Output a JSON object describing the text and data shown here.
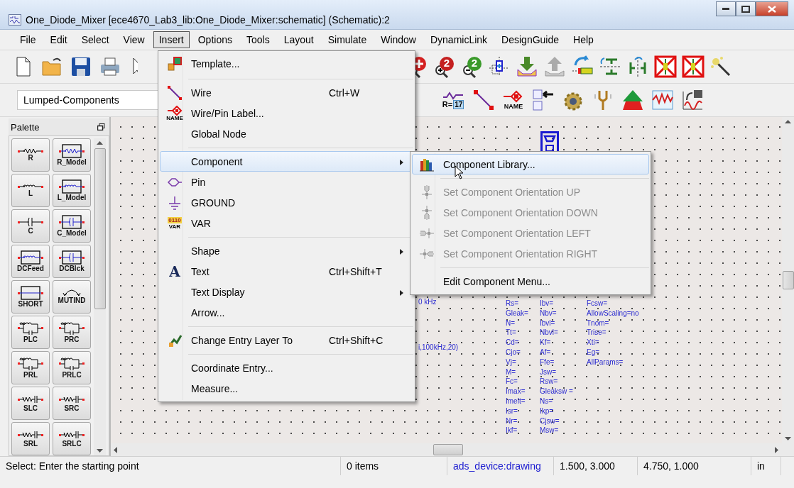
{
  "window": {
    "title": "One_Diode_Mixer [ece4670_Lab3_lib:One_Diode_Mixer:schematic] (Schematic):2"
  },
  "menu_bar": [
    {
      "label": "File",
      "selected": false
    },
    {
      "label": "Edit",
      "selected": false
    },
    {
      "label": "Select",
      "selected": false
    },
    {
      "label": "View",
      "selected": false
    },
    {
      "label": "Insert",
      "selected": true
    },
    {
      "label": "Options",
      "selected": false
    },
    {
      "label": "Tools",
      "selected": false
    },
    {
      "label": "Layout",
      "selected": false
    },
    {
      "label": "Simulate",
      "selected": false
    },
    {
      "label": "Window",
      "selected": false
    },
    {
      "label": "DynamicLink",
      "selected": false
    },
    {
      "label": "DesignGuide",
      "selected": false
    },
    {
      "label": "Help",
      "selected": false
    }
  ],
  "toolbar_1": {
    "left": [
      {
        "kind": "new"
      },
      {
        "kind": "open"
      },
      {
        "kind": "save"
      },
      {
        "kind": "print"
      },
      {
        "kind": "pointer"
      }
    ],
    "right": [
      {
        "kind": "zoom-in"
      },
      {
        "kind": "zoom-in-2",
        "glyph": "2"
      },
      {
        "kind": "zoom-out-2",
        "glyph": "2"
      },
      {
        "kind": "center"
      },
      {
        "kind": "push-down"
      },
      {
        "kind": "pop-up"
      },
      {
        "kind": "rotate"
      },
      {
        "kind": "mirror-x"
      },
      {
        "kind": "mirror-y"
      },
      {
        "kind": "deactivate"
      },
      {
        "kind": "deactivate-short"
      },
      {
        "kind": "wand"
      }
    ]
  },
  "toolbar_2": {
    "library": "Lumped-Components",
    "tools": [
      {
        "kind": "equation",
        "text": "R=",
        "glyph": "17"
      },
      {
        "kind": "wire"
      },
      {
        "kind": "name",
        "text": "NAME"
      },
      {
        "kind": "copy-schematic"
      },
      {
        "kind": "gear"
      },
      {
        "kind": "tuning-fork"
      },
      {
        "kind": "optimize"
      },
      {
        "kind": "graph"
      },
      {
        "kind": "graph-save"
      }
    ]
  },
  "palette": {
    "title": "Palette",
    "items": [
      {
        "label": "R",
        "kind": "resistor",
        "boxed": false
      },
      {
        "label": "R_Model",
        "kind": "resistor",
        "boxed": true
      },
      {
        "label": "L",
        "kind": "inductor",
        "boxed": false
      },
      {
        "label": "L_Model",
        "kind": "inductor",
        "boxed": true
      },
      {
        "label": "C",
        "kind": "capacitor",
        "boxed": false
      },
      {
        "label": "C_Model",
        "kind": "capacitor",
        "boxed": true
      },
      {
        "label": "DCFeed",
        "kind": "inductor",
        "boxed": true
      },
      {
        "label": "DCBlck",
        "kind": "capacitor",
        "boxed": true
      },
      {
        "label": "SHORT",
        "kind": "short",
        "boxed": true
      },
      {
        "label": "MUTIND",
        "kind": "mutual",
        "boxed": false
      },
      {
        "label": "PLC",
        "kind": "parallel",
        "boxed": false
      },
      {
        "label": "PRC",
        "kind": "parallel",
        "boxed": false
      },
      {
        "label": "PRL",
        "kind": "parallel",
        "boxed": false
      },
      {
        "label": "PRLC",
        "kind": "parallel",
        "boxed": false
      },
      {
        "label": "SLC",
        "kind": "series",
        "boxed": false
      },
      {
        "label": "SRC",
        "kind": "series",
        "boxed": false
      },
      {
        "label": "SRL",
        "kind": "series",
        "boxed": false
      },
      {
        "label": "SRLC",
        "kind": "series",
        "boxed": false
      }
    ]
  },
  "canvas": {
    "notes": [
      "0 kHz",
      "i,100kHz,20)"
    ],
    "parameter_columns": [
      [
        "Rs=",
        "Gleak=",
        "N=",
        "Tt=",
        "Cd=",
        "Cjo=",
        "Vj=",
        "M=",
        "Fc=",
        "Imax=",
        "Imelt=",
        "Isr=",
        "Nr=",
        "Ikf="
      ],
      [
        "Ibv=",
        "Nbv=",
        "Ibvl=",
        "Nbvl=",
        "Kf=",
        "Af=",
        "Ffe=",
        "Jsw=",
        "Rsw=",
        "Gleaksw =",
        "Ns=",
        "Ikp=",
        "Cjsw=",
        "Msw="
      ],
      [
        "Fcsw=",
        "AllowScaling=no",
        "Tnom=",
        "Trise=",
        "Xti=",
        "Eg=",
        "AllParams="
      ]
    ]
  },
  "insert_menu": [
    {
      "kind": "template",
      "label": "Template...",
      "selected": false,
      "submenu": false
    },
    {
      "kind": "separator"
    },
    {
      "kind": "wire",
      "label": "Wire",
      "shortcut": "Ctrl+W",
      "selected": false,
      "submenu": false
    },
    {
      "kind": "label",
      "icon_text": "NAME",
      "label": "Wire/Pin Label...",
      "selected": false,
      "submenu": false
    },
    {
      "kind": "plain",
      "label": "Global Node",
      "selected": false,
      "submenu": false
    },
    {
      "kind": "separator"
    },
    {
      "kind": "plain",
      "label": "Component",
      "selected": true,
      "submenu": true
    },
    {
      "kind": "pin",
      "label": "Pin",
      "selected": false,
      "submenu": false
    },
    {
      "kind": "ground",
      "label": "GROUND",
      "selected": false,
      "submenu": false
    },
    {
      "kind": "variable",
      "icon_text": "0110",
      "icon_text_2": "VAR",
      "label": "VAR",
      "selected": false,
      "submenu": false
    },
    {
      "kind": "separator"
    },
    {
      "kind": "plain",
      "label": "Shape",
      "selected": false,
      "submenu": true
    },
    {
      "kind": "letter",
      "icon_text": "A",
      "label": "Text",
      "shortcut": "Ctrl+Shift+T",
      "selected": false,
      "submenu": false
    },
    {
      "kind": "plain",
      "label": "Text Display",
      "selected": false,
      "submenu": true
    },
    {
      "kind": "plain",
      "label": "Arrow...",
      "selected": false,
      "submenu": false
    },
    {
      "kind": "separator"
    },
    {
      "kind": "layer",
      "label": "Change Entry Layer To",
      "shortcut": "Ctrl+Shift+C",
      "selected": false,
      "submenu": false
    },
    {
      "kind": "separator"
    },
    {
      "kind": "plain",
      "label": "Coordinate Entry...",
      "selected": false,
      "submenu": false
    },
    {
      "kind": "plain",
      "label": "Measure...",
      "selected": false,
      "submenu": false
    }
  ],
  "component_submenu": [
    {
      "kind": "library",
      "label": "Component Library...",
      "selected": true,
      "disabled": false
    },
    {
      "kind": "separator"
    },
    {
      "kind": "up",
      "label": "Set Component Orientation UP",
      "selected": false,
      "disabled": true
    },
    {
      "kind": "down",
      "label": "Set Component Orientation DOWN",
      "selected": false,
      "disabled": true
    },
    {
      "kind": "left",
      "label": "Set Component Orientation LEFT",
      "selected": false,
      "disabled": true
    },
    {
      "kind": "right",
      "label": "Set Component Orientation RIGHT",
      "selected": false,
      "disabled": true
    },
    {
      "kind": "separator"
    },
    {
      "kind": "plain",
      "label": "Edit Component Menu...",
      "selected": false,
      "disabled": false
    }
  ],
  "status_bar": [
    {
      "text": "Select: Enter the starting point",
      "kind": "plain"
    },
    {
      "text": "0 items",
      "kind": "plain"
    },
    {
      "text": "ads_device:drawing",
      "kind": "layer"
    },
    {
      "text": "1.500, 3.000",
      "kind": "plain"
    },
    {
      "text": "4.750, 1.000",
      "kind": "plain"
    },
    {
      "text": "in",
      "kind": "plain"
    }
  ]
}
